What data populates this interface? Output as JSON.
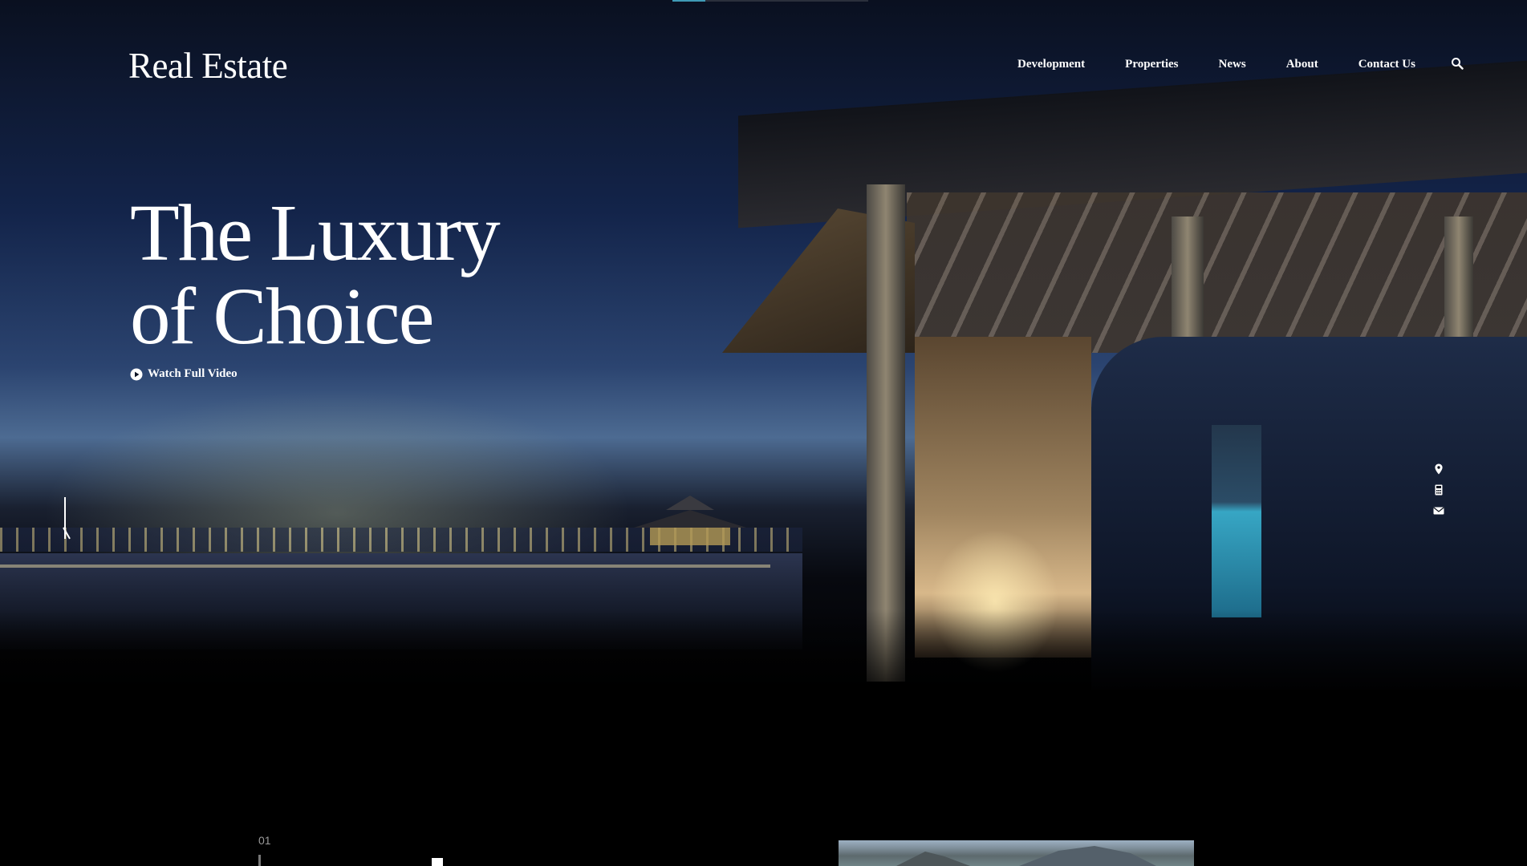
{
  "header": {
    "logo": "Real Estate",
    "nav": [
      "Development",
      "Properties",
      "News",
      "About",
      "Contact Us"
    ],
    "search_icon": "search-icon"
  },
  "hero": {
    "title_line1": "The Luxury",
    "title_line2": "of Choice",
    "video_link": "Watch Full Video",
    "video_icon": "play-circle-icon",
    "slider_progress": 0.17
  },
  "side_icons": [
    "location-pin-icon",
    "calculator-icon",
    "mail-icon"
  ],
  "next_section": {
    "number": "01"
  },
  "colors": {
    "background": "#000000",
    "accent": "#3f9ab5",
    "text": "#ffffff"
  }
}
